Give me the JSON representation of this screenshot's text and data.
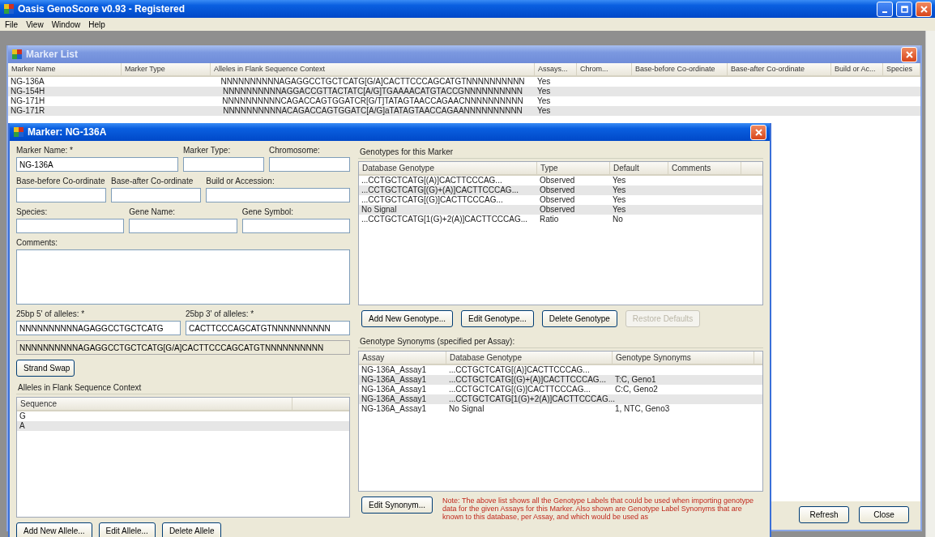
{
  "window": {
    "title": "Oasis GenoScore v0.93 - Registered"
  },
  "menu": [
    "File",
    "View",
    "Window",
    "Help"
  ],
  "marker_list": {
    "title": "Marker List",
    "columns": [
      "Marker Name",
      "Marker Type",
      "Alleles in Flank Sequence Context",
      "Assays...",
      "Chrom...",
      "Base-before Co-ordinate",
      "Base-after Co-ordinate",
      "Build or Ac...",
      "Species"
    ],
    "rows": [
      {
        "marker_name": "NG-136A",
        "alleles": "NNNNNNNNNNAGAGGCCTGCTCATG[G/A]CACTTCCCAGCATGTNNNNNNNNNN",
        "assays": "Yes"
      },
      {
        "marker_name": "NG-154H",
        "alleles": "NNNNNNNNNNAGGACCGTTACTATC[A/G]TGAAAACATGTACCGNNNNNNNNNN",
        "assays": "Yes"
      },
      {
        "marker_name": "NG-171H",
        "alleles": "NNNNNNNNNNCAGACCAGTGGATCR[G/T]TATAGTAACCAGAACNNNNNNNNNN",
        "assays": "Yes"
      },
      {
        "marker_name": "NG-171R",
        "alleles": "NNNNNNNNNNACAGACCAGTGGATC[A/G]aTATAGTAACCAGAANNNNNNNNNN",
        "assays": "Yes"
      }
    ],
    "buttons": [
      "Refresh",
      "Close"
    ]
  },
  "marker_dialog": {
    "title": "Marker: NG-136A",
    "field_rows": [
      [
        {
          "kind": "text",
          "label": "Marker Name: *",
          "value": "NG-136A"
        },
        {
          "kind": "text",
          "label": "Marker Type:"
        },
        {
          "kind": "text",
          "label": "Chromosome:"
        }
      ],
      [
        {
          "kind": "text",
          "label": "Base-before Co-ordinate"
        },
        {
          "kind": "text",
          "label": "Base-after Co-ordinate"
        },
        {
          "kind": "text",
          "label": "Build or Accession:"
        }
      ],
      [
        {
          "kind": "text",
          "label": "Species:"
        },
        {
          "kind": "text",
          "label": "Gene Name:"
        },
        {
          "kind": "text",
          "label": "Gene Symbol:"
        }
      ],
      [
        {
          "kind": "textarea",
          "label": "Comments:"
        }
      ],
      [
        {
          "kind": "text",
          "label": "25bp 5' of alleles: *",
          "value": "NNNNNNNNNNAGAGGCCTGCTCATG"
        },
        {
          "kind": "text",
          "label": "25bp 3' of alleles: *",
          "value": "CACTTCCCAGCATGTNNNNNNNNNN"
        }
      ],
      [
        {
          "kind": "readonly",
          "value": "NNNNNNNNNNAGAGGCCTGCTCATG[G/A]CACTTCCCAGCATGTNNNNNNNNNN"
        }
      ]
    ],
    "strand_swap": "Strand Swap",
    "alleles": {
      "title": "Alleles in Flank Sequence Context",
      "columns": [
        "Sequence"
      ],
      "rows": [
        "G",
        "A"
      ],
      "buttons": [
        "Add New Allele...",
        "Edit Allele...",
        "Delete Allele"
      ]
    },
    "genotypes": {
      "title": "Genotypes for this Marker",
      "columns": [
        "Database Genotype",
        "Type",
        "Default",
        "Comments"
      ],
      "rows": [
        {
          "genotype": "...CCTGCTCATG[(A)]CACTTCCCAG...",
          "type": "Observed",
          "default": "Yes"
        },
        {
          "genotype": "...CCTGCTCATG[(G)+(A)]CACTTCCCAG...",
          "type": "Observed",
          "default": "Yes"
        },
        {
          "genotype": "...CCTGCTCATG[(G)]CACTTCCCAG...",
          "type": "Observed",
          "default": "Yes"
        },
        {
          "genotype": "No Signal",
          "type": "Observed",
          "default": "Yes"
        },
        {
          "genotype": "...CCTGCTCATG[1(G)+2(A)]CACTTCCCAG...",
          "type": "Ratio",
          "default": "No"
        }
      ],
      "buttons": [
        {
          "label": "Add New Genotype...",
          "disabled": false
        },
        {
          "label": "Edit Genotype...",
          "disabled": false
        },
        {
          "label": "Delete Genotype",
          "disabled": false
        },
        {
          "label": "Restore Defaults",
          "disabled": true
        }
      ]
    },
    "synonyms": {
      "title": "Genotype Synonyms (specified per Assay):",
      "columns": [
        "Assay",
        "Database Genotype",
        "Genotype Synonyms"
      ],
      "rows": [
        {
          "assay": "NG-136A_Assay1",
          "genotype": "...CCTGCTCATG[(A)]CACTTCCCAG..."
        },
        {
          "assay": "NG-136A_Assay1",
          "genotype": "...CCTGCTCATG[(G)+(A)]CACTTCCCAG...",
          "synonym": "T:C, Geno1"
        },
        {
          "assay": "NG-136A_Assay1",
          "genotype": "...CCTGCTCATG[(G)]CACTTCCCAG...",
          "synonym": "C:C, Geno2"
        },
        {
          "assay": "NG-136A_Assay1",
          "genotype": "...CCTGCTCATG[1(G)+2(A)]CACTTCCCAG..."
        },
        {
          "assay": "NG-136A_Assay1",
          "genotype": "No Signal",
          "synonym": "1, NTC, Geno3"
        }
      ],
      "button": "Edit Synonym...",
      "note": "Note: The above list shows all the Genotype Labels that could be used when importing genotype data for the given Assays for this Marker. Also shown are Genotype Label Synonyms that are known to this database, per Assay, and which would be used as"
    }
  }
}
